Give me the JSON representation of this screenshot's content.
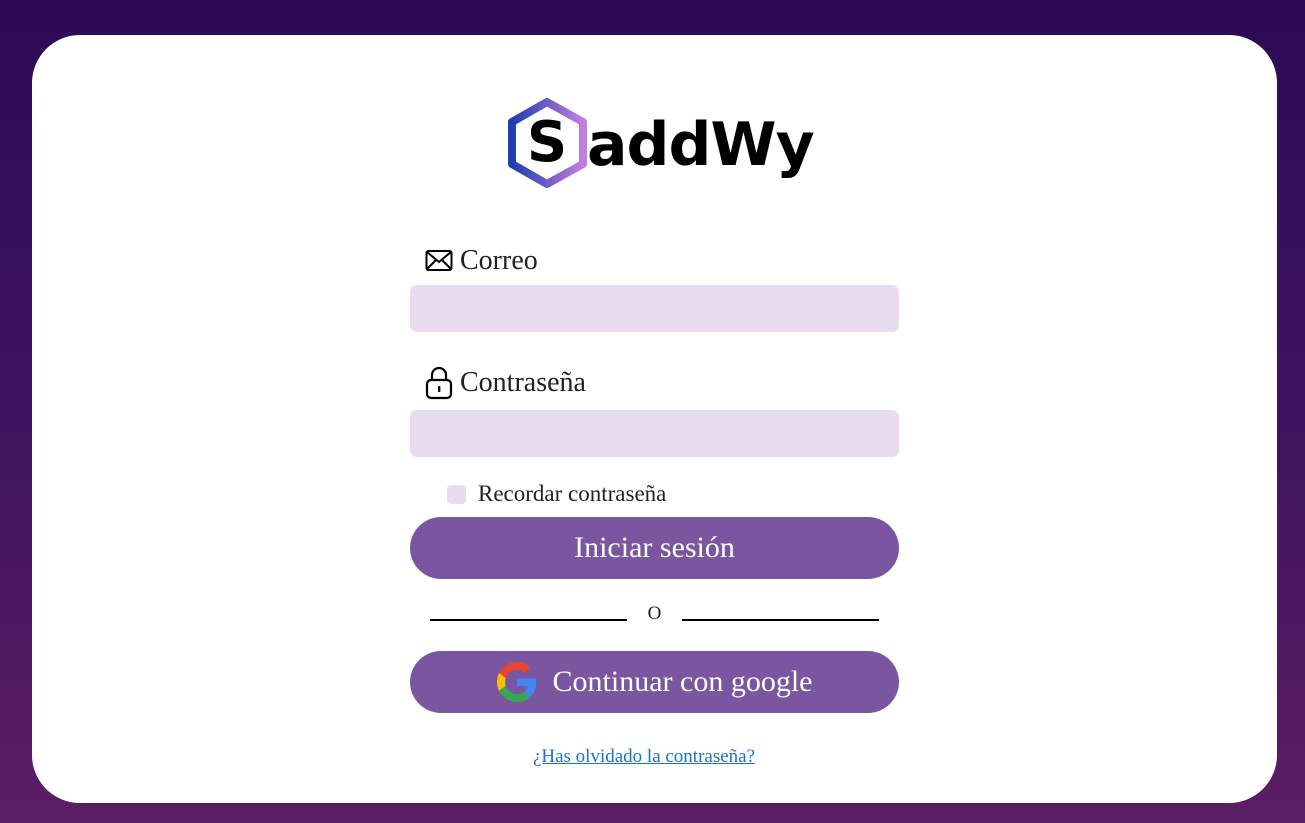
{
  "brand": {
    "logo_letter": "S",
    "logo_word": "addWy",
    "colors": {
      "hex_gradient_start": "#1f3fae",
      "hex_gradient_end": "#c07ee0"
    }
  },
  "form": {
    "email": {
      "icon": "envelope-icon",
      "label": "Correo",
      "value": "",
      "placeholder": ""
    },
    "password": {
      "icon": "lock-icon",
      "label": "Contraseña",
      "value": "",
      "placeholder": ""
    },
    "remember": {
      "label": "Recordar contraseña",
      "checked": false
    },
    "login_button": "Iniciar sesión",
    "divider_text": "O",
    "google_button": {
      "icon": "google-icon",
      "label": "Continuar con google"
    },
    "forgot_link": "¿Has olvidado la contraseña?"
  },
  "colors": {
    "background_top": "#2d0a55",
    "background_bottom": "#5a1e64",
    "card": "#ffffff",
    "input_fill": "#e9dcf0",
    "button": "#7a56a0",
    "link": "#1a6fd9"
  }
}
